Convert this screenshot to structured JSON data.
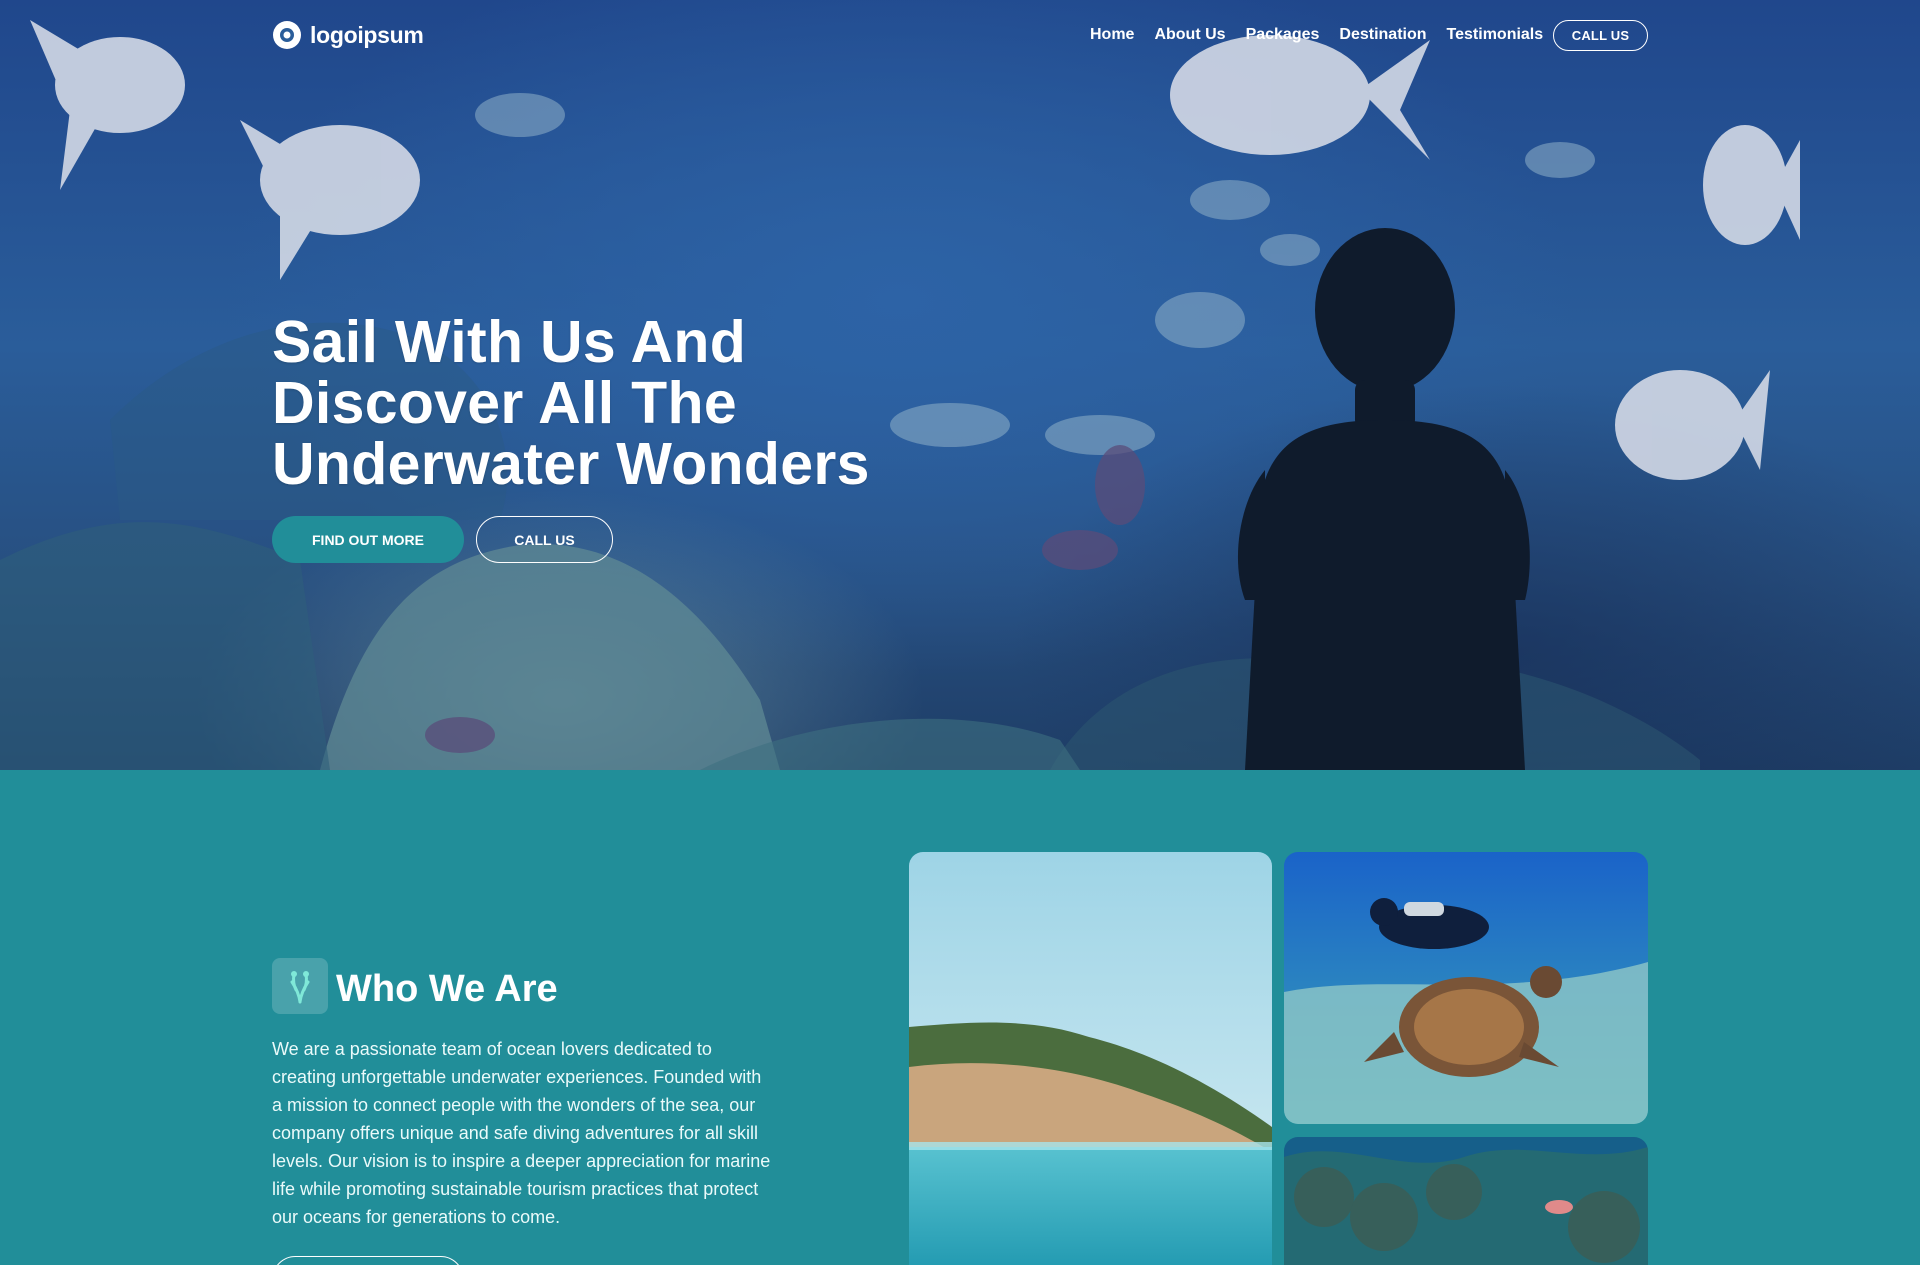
{
  "header": {
    "logo_text": "logoipsum",
    "nav": [
      {
        "label": "Home",
        "active": true
      },
      {
        "label": "About Us",
        "active": false
      },
      {
        "label": "Packages",
        "active": false
      },
      {
        "label": "Destination",
        "active": false
      },
      {
        "label": "Testimonials",
        "active": false
      }
    ],
    "call_label": "CALL US"
  },
  "hero": {
    "title_lines": [
      "Sail With Us And",
      "Discover All The",
      "Underwater Wonders"
    ],
    "primary_button": "FIND OUT MORE",
    "secondary_button": "CALL US"
  },
  "about": {
    "title": "Who We Are",
    "body": "We are a passionate team of ocean lovers dedicated to creating unforgettable underwater experiences. Founded with a mission to connect people with the wonders of the sea, our company offers unique and safe diving adventures for all skill levels. Our vision is to inspire a deeper appreciation for marine life while promoting sustainable tourism practices that protect our oceans for generations to come.",
    "icon": "coral-icon"
  },
  "colors": {
    "teal": "#218e99",
    "hero_blue": "#2a5d9a",
    "white": "#ffffff"
  }
}
